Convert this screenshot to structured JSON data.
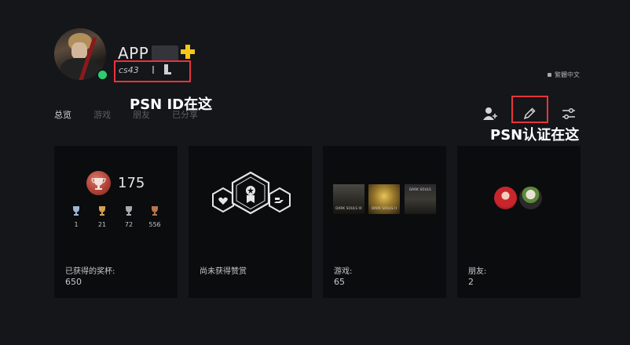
{
  "profile": {
    "username": "APP",
    "psn_id": "cs43",
    "online_status_color": "#2ecc71",
    "plus_color": "#f5c518"
  },
  "annotations": {
    "psn_id_note": "PSN ID在这",
    "verify_note": "PSN认证在这",
    "highlight_color": "#e8343b"
  },
  "language_label": "繁體中文",
  "tabs": [
    {
      "label": "总览",
      "active": true
    },
    {
      "label": "游戏",
      "active": false
    },
    {
      "label": "朋友",
      "active": false
    },
    {
      "label": "已分享",
      "active": false
    }
  ],
  "toolbar": {
    "icons": [
      "person-add-icon",
      "edit-pencil-icon",
      "settings-sliders-icon"
    ]
  },
  "cards": {
    "trophies": {
      "level": "175",
      "platinum": "1",
      "gold": "21",
      "silver": "72",
      "bronze": "556",
      "label": "已获得的奖杯:",
      "value": "650"
    },
    "rewards": {
      "label": "尚未获得赞赏"
    },
    "games": {
      "titles": [
        "DARK SOULS III",
        "DARK SOULS II",
        "DARK SOULS"
      ],
      "label": "游戏:",
      "value": "65"
    },
    "friends": {
      "label": "朋友:",
      "value": "2"
    }
  }
}
